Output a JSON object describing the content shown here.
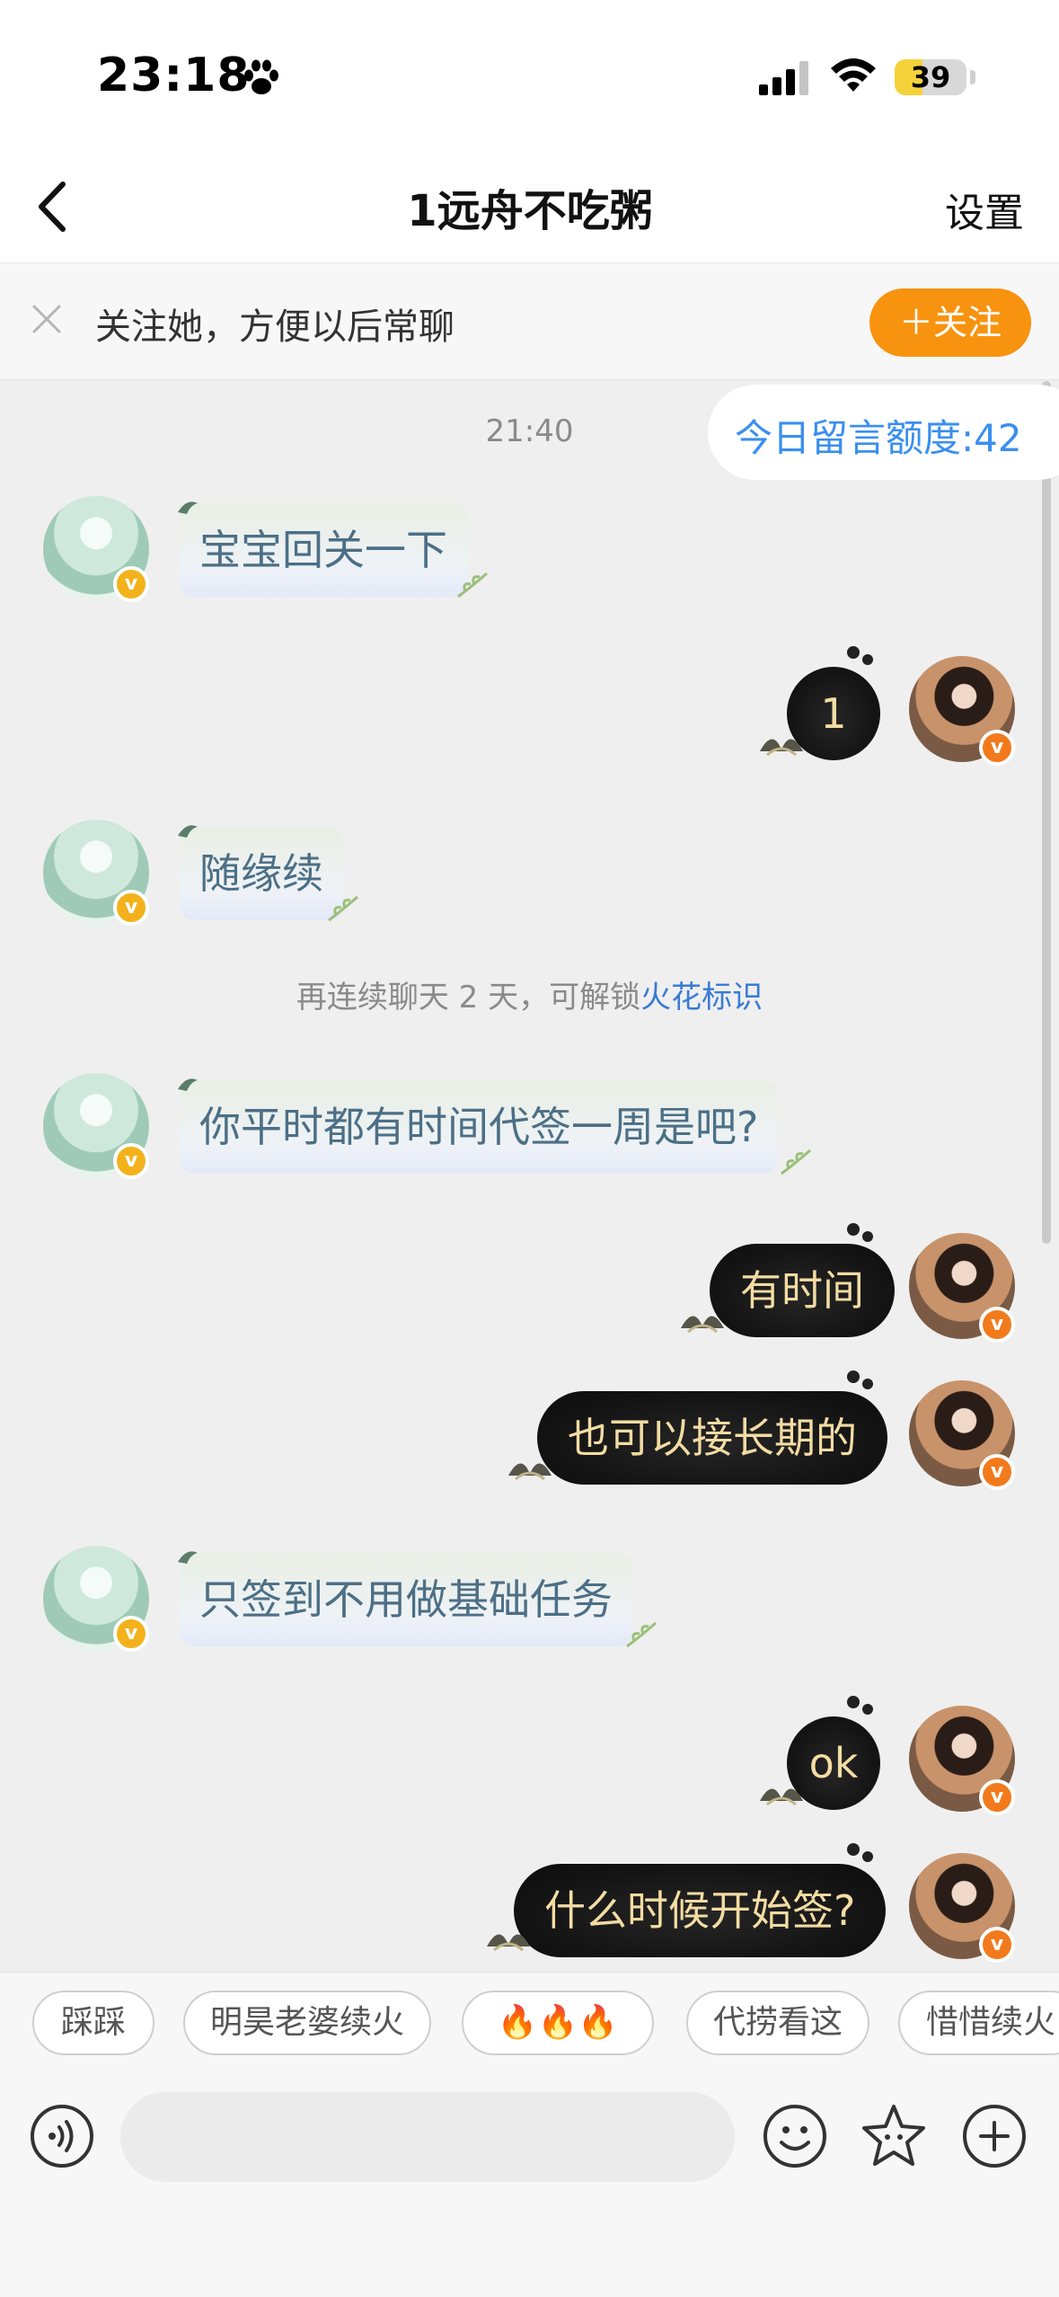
{
  "status_bar": {
    "time": "23:18",
    "battery": "39",
    "battery_level": 0.39,
    "icons": [
      "paw-icon",
      "signal-icon",
      "wifi-icon",
      "battery-icon"
    ]
  },
  "header": {
    "back_icon": "chevron-left-icon",
    "title": "1远舟不吃粥",
    "settings_label": "设置"
  },
  "follow_banner": {
    "close_icon": "close-icon",
    "text": "关注她，方便以后常聊",
    "button_label": "＋关注"
  },
  "chat": {
    "timestamp": "21:40",
    "quota": "今日留言额度:42",
    "system_note": {
      "prefix": "再连续聊天 2 天，可解锁",
      "link": "火花标识"
    },
    "messages": [
      {
        "side": "in",
        "text": "宝宝回关一下"
      },
      {
        "side": "out",
        "text": "1"
      },
      {
        "side": "in",
        "text": "随缘续"
      },
      {
        "side": "in",
        "text": "你平时都有时间代签一周是吧?"
      },
      {
        "side": "out",
        "text": "有时间"
      },
      {
        "side": "out",
        "text": "也可以接长期的"
      },
      {
        "side": "in",
        "text": "只签到不用做基础任务"
      },
      {
        "side": "out",
        "text": "ok"
      },
      {
        "side": "out",
        "text": "什么时候开始签?"
      }
    ],
    "badge_mark": "v"
  },
  "quick_replies": [
    "踩踩",
    "明昊老婆续火",
    "🔥🔥🔥",
    "代捞看这",
    "惜惜续火"
  ],
  "input_bar": {
    "placeholder": "",
    "icons": [
      "voice-icon",
      "emoji-icon",
      "star-icon",
      "plus-icon"
    ]
  },
  "colors": {
    "accent_orange": "#f8930f",
    "link_blue": "#3a8ff0",
    "bubble_out_text": "#f3dca3",
    "bubble_in_text": "#4c6f86"
  }
}
